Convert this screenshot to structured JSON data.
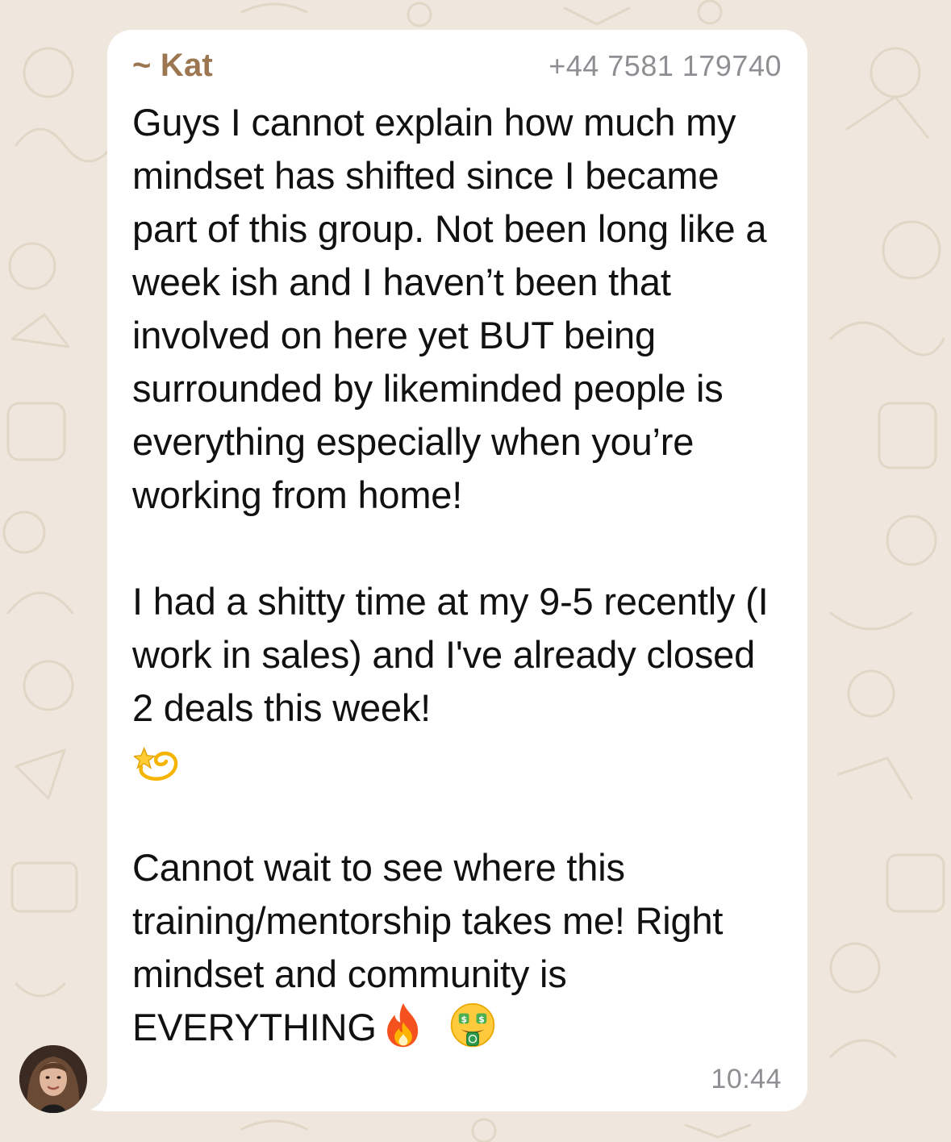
{
  "message": {
    "sender_name": "~ Kat",
    "sender_phone": "+44 7581 179740",
    "paragraph_1": "Guys I cannot explain how much my mindset has shifted since I became part of this group. Not been long like a week ish and I haven’t been that involved on here yet BUT being surrounded by likeminded people is everything especially when you’re working from home!",
    "paragraph_2": "I had a shitty time at my 9-5 recently (I work in sales) and I've already closed 2 deals this week!",
    "paragraph_3": "Cannot wait to see where this training/mentorship takes me! Right mindset and community is",
    "paragraph_3_end": "EVERYTHING",
    "time": "10:44"
  },
  "icons": {
    "dizzy": "dizzy-star-emoji",
    "fire": "fire-emoji",
    "money_mouth": "money-mouth-face-emoji",
    "avatar": "sender-avatar"
  },
  "colors": {
    "background": "#efe7dd",
    "bubble": "#ffffff",
    "sender_name": "#9c7651",
    "meta_text": "#8e8e93"
  }
}
